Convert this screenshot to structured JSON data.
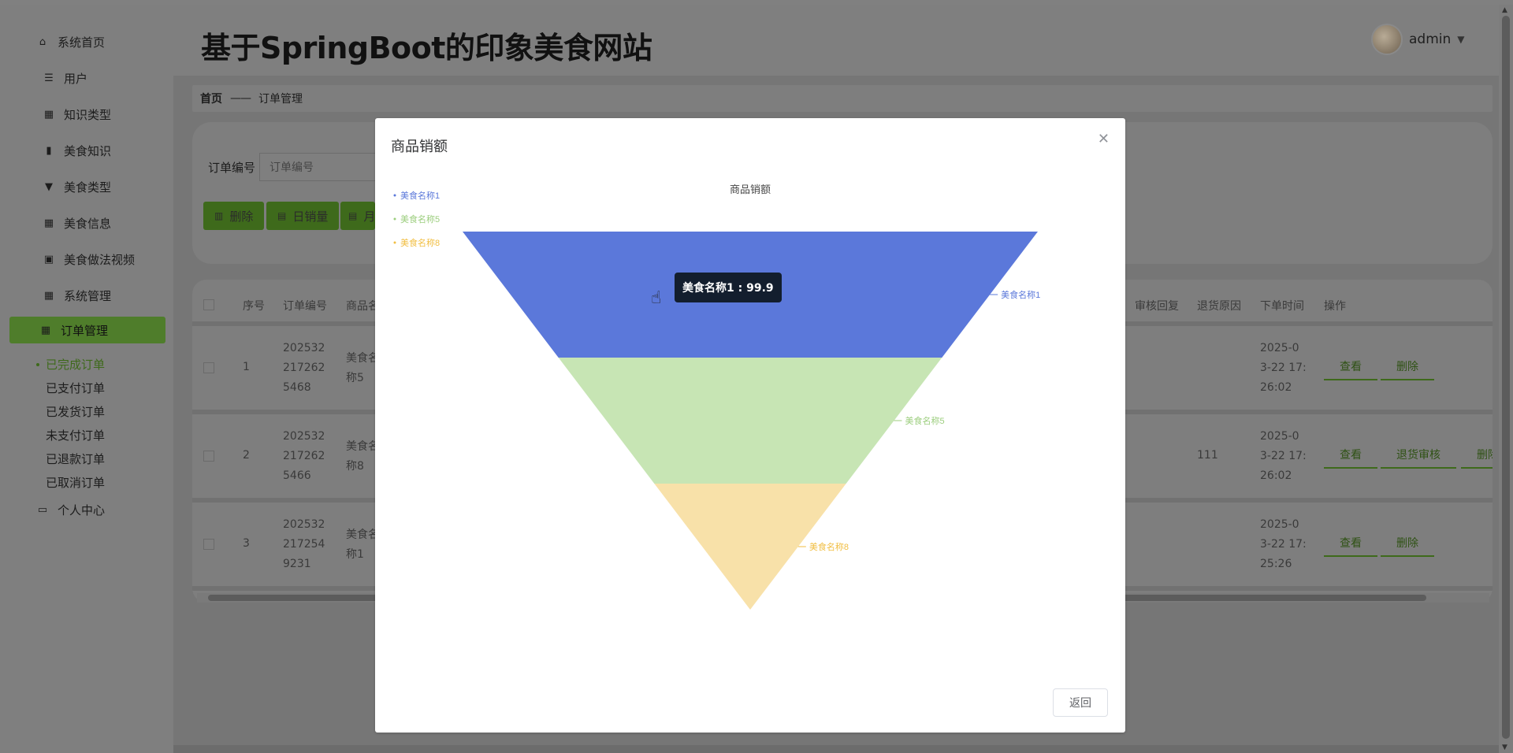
{
  "app": {
    "title": "基于SpringBoot的印象美食网站",
    "username": "admin"
  },
  "sidebar": {
    "items": [
      {
        "label": "系统首页",
        "icon": "home-icon"
      },
      {
        "label": "用户",
        "icon": "list-icon"
      },
      {
        "label": "知识类型",
        "icon": "grid-icon"
      },
      {
        "label": "美食知识",
        "icon": "bar-chart-icon"
      },
      {
        "label": "美食类型",
        "icon": "tag-icon"
      },
      {
        "label": "美食信息",
        "icon": "grid-icon"
      },
      {
        "label": "美食做法视频",
        "icon": "clipboard-icon"
      },
      {
        "label": "系统管理",
        "icon": "grid-icon"
      },
      {
        "label": "订单管理",
        "icon": "grid-icon"
      },
      {
        "label": "个人中心",
        "icon": "card-icon"
      }
    ],
    "sub_items": [
      "已完成订单",
      "已支付订单",
      "已发货订单",
      "未支付订单",
      "已退款订单",
      "已取消订单"
    ]
  },
  "breadcrumb": {
    "home": "首页",
    "separator": "——",
    "current": "订单管理"
  },
  "search": {
    "label": "订单编号",
    "placeholder": "订单编号"
  },
  "actions": {
    "delete": "删除",
    "daily_sales": "日销量",
    "monthly_prefix": "月"
  },
  "table": {
    "headers_left": [
      "序号",
      "订单编号",
      "商品名"
    ],
    "headers_right": [
      "审核回复",
      "退货原因",
      "下单时间",
      "操作"
    ],
    "rows": [
      {
        "index": "1",
        "order_no": [
          "202532",
          "217262",
          "5468"
        ],
        "product": [
          "美食名",
          "称5"
        ],
        "return_reason": "",
        "time": [
          "2025-0",
          "3-22 17:",
          "26:02"
        ],
        "ops": [
          "查看",
          "删除"
        ]
      },
      {
        "index": "2",
        "order_no": [
          "202532",
          "217262",
          "5466"
        ],
        "product": [
          "美食名",
          "称8"
        ],
        "return_reason": "111",
        "time": [
          "2025-0",
          "3-22 17:",
          "26:02"
        ],
        "ops": [
          "查看",
          "退货审核",
          "删除"
        ]
      },
      {
        "index": "3",
        "order_no": [
          "202532",
          "217254",
          "9231"
        ],
        "product": [
          "美食名",
          "称1"
        ],
        "return_reason": "",
        "time": [
          "2025-0",
          "3-22 17:",
          "25:26"
        ],
        "ops": [
          "查看",
          "删除"
        ]
      }
    ]
  },
  "modal": {
    "title": "商品销额",
    "back_button": "返回",
    "tooltip": "美食名称1 : 99.9"
  },
  "chart_data": {
    "type": "funnel",
    "title": "商品销额",
    "legend_placement": "top-left",
    "categories": [
      "美食名称1",
      "美食名称5",
      "美食名称8"
    ],
    "values": [
      99.9,
      66.6,
      33.3
    ],
    "colors": [
      "#5b78da",
      "#c7e5b4",
      "#f8e1a9"
    ],
    "label_colors": [
      "#5b78da",
      "#9cce7e",
      "#f1be42"
    ]
  },
  "colors": {
    "accent": "#3e6a1b",
    "overlay": "#808080"
  }
}
